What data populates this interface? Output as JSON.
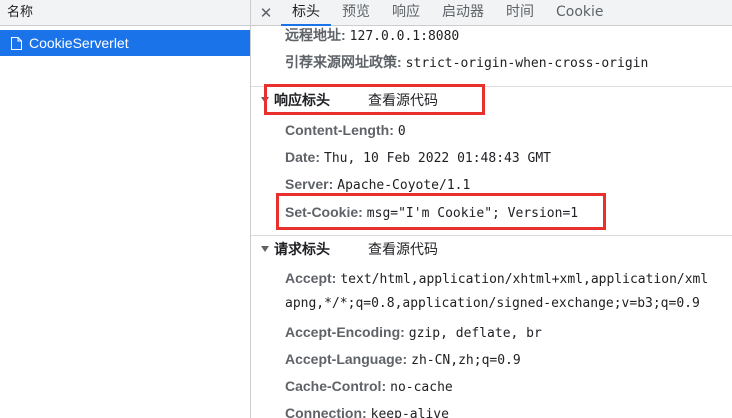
{
  "left_panel": {
    "header": "名称",
    "request": "CookieServerlet"
  },
  "tabs": [
    {
      "label": "标头",
      "active": true
    },
    {
      "label": "预览"
    },
    {
      "label": "响应"
    },
    {
      "label": "启动器"
    },
    {
      "label": "时间"
    },
    {
      "label": "Cookie"
    }
  ],
  "general": {
    "remote_address": {
      "name": "远程地址:",
      "value": "127.0.0.1:8080"
    },
    "referrer_policy": {
      "name": "引荐来源网址政策:",
      "value": "strict-origin-when-cross-origin"
    }
  },
  "response_headers": {
    "title": "响应标头",
    "view_source": "查看源代码",
    "items": [
      {
        "name": "Content-Length:",
        "value": "0"
      },
      {
        "name": "Date:",
        "value": "Thu, 10 Feb 2022 01:48:43 GMT"
      },
      {
        "name": "Server:",
        "value": "Apache-Coyote/1.1"
      },
      {
        "name": "Set-Cookie:",
        "value": "msg=\"I'm Cookie\"; Version=1"
      }
    ]
  },
  "request_headers": {
    "title": "请求标头",
    "view_source": "查看源代码",
    "items": [
      {
        "name": "Accept:",
        "value": "text/html,application/xhtml+xml,application/xml",
        "continuation": "apng,*/*;q=0.8,application/signed-exchange;v=b3;q=0.9"
      },
      {
        "name": "Accept-Encoding:",
        "value": "gzip, deflate, br"
      },
      {
        "name": "Accept-Language:",
        "value": "zh-CN,zh;q=0.9"
      },
      {
        "name": "Cache-Control:",
        "value": "no-cache"
      },
      {
        "name": "Connection:",
        "value": "keep-alive"
      }
    ]
  },
  "colors": {
    "accent": "#1a73e8",
    "highlight": "#e8302c"
  }
}
